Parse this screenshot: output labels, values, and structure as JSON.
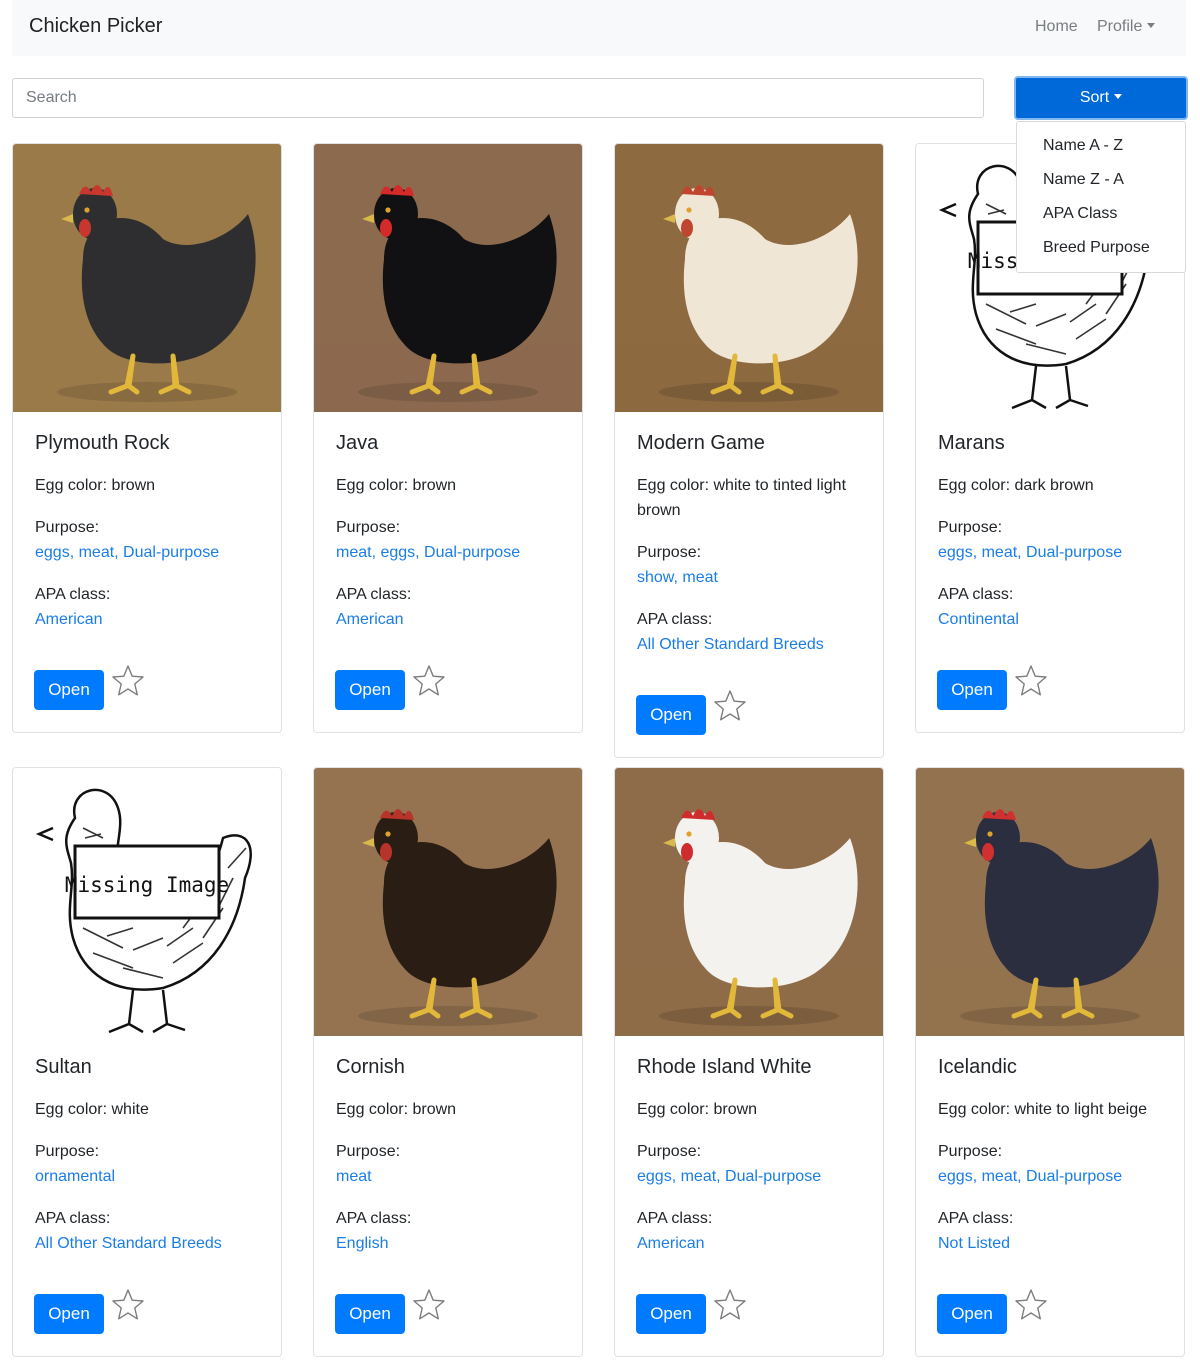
{
  "navbar": {
    "brand": "Chicken Picker",
    "home": "Home",
    "profile": "Profile"
  },
  "search": {
    "placeholder": "Search",
    "value": ""
  },
  "sort": {
    "label": "Sort",
    "options": [
      "Name A - Z",
      "Name Z - A",
      "APA Class",
      "Breed Purpose"
    ]
  },
  "card_text": {
    "egg_prefix": "Egg color: ",
    "purpose_label": "Purpose:",
    "apa_label": "APA class:",
    "open_label": "Open"
  },
  "missing_image_text": "Missing Image",
  "cards": [
    {
      "name": "Plymouth Rock",
      "egg_color": "brown",
      "purpose": "eggs, meat, Dual-purpose",
      "apa_class": "American",
      "image": "photo",
      "bird": "#2e2e30",
      "comb": "#c8372e",
      "bg": "#9b7a4a",
      "favorite": false
    },
    {
      "name": "Java",
      "egg_color": "brown",
      "purpose": "meat, eggs, Dual-purpose",
      "apa_class": "American",
      "image": "photo",
      "bird": "#111114",
      "comb": "#d42a2a",
      "bg": "#8c6a4e",
      "favorite": false
    },
    {
      "name": "Modern Game",
      "egg_color": "white to tinted light brown",
      "purpose": "show, meat",
      "apa_class": "All Other Standard Breeds",
      "image": "photo",
      "bird": "#efe6d6",
      "comb": "#c0452e",
      "bg": "#8d6a40",
      "favorite": false
    },
    {
      "name": "Marans",
      "egg_color": "dark brown",
      "purpose": "eggs, meat, Dual-purpose",
      "apa_class": "Continental",
      "image": "missing",
      "favorite": false
    },
    {
      "name": "Sultan",
      "egg_color": "white",
      "purpose": "ornamental",
      "apa_class": "All Other Standard Breeds",
      "image": "missing",
      "favorite": false
    },
    {
      "name": "Cornish",
      "egg_color": "brown",
      "purpose": "meat",
      "apa_class": "English",
      "image": "photo",
      "bird": "#2a1d14",
      "comb": "#b8342b",
      "bg": "#957350",
      "favorite": false
    },
    {
      "name": "Rhode Island White",
      "egg_color": "brown",
      "purpose": "eggs, meat, Dual-purpose",
      "apa_class": "American",
      "image": "photo",
      "bird": "#f4f2ef",
      "comb": "#cf2d2d",
      "bg": "#8e6c49",
      "favorite": false
    },
    {
      "name": "Icelandic",
      "egg_color": "white to light beige",
      "purpose": "eggs, meat, Dual-purpose",
      "apa_class": "Not Listed",
      "image": "photo",
      "bird": "#2b2e3e",
      "comb": "#d13030",
      "bg": "#93724f",
      "favorite": false
    }
  ],
  "colors": {
    "primary": "#007bff",
    "link": "#1a7de8",
    "navbar_bg": "#f8f9fa",
    "star_outline": "#7d7d7d"
  }
}
